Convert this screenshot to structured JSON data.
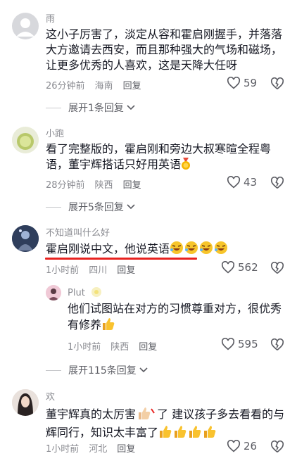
{
  "comments": [
    {
      "user": "雨",
      "text_lines": [
        "这小子厉害了，淡定从容和霍启刚握手，并落落",
        "大方邀请去西安，而且那种强大的气场和磁场，",
        "让更多优秀的人喜欢，这是天降大任呀"
      ],
      "time": "26分钟前",
      "location": "海南",
      "reply": "回复",
      "likes": "59",
      "expand": "展开1条回复"
    },
    {
      "user": "小跑",
      "text_lines": [
        "看了完整版的，霍启刚和旁边大叔寒暄全程粤",
        "语，董宇辉搭话只好用英语"
      ],
      "time": "28分钟前",
      "location": "陕西",
      "reply": "回复",
      "likes": "43",
      "expand": "展开5条回复"
    },
    {
      "user": "不知道叫什么好",
      "text_lines": [
        "霍启刚说中文，他说英语"
      ],
      "time": "1小时前",
      "location": "四川",
      "reply": "回复",
      "likes": "562",
      "reply_item": {
        "user": "Plut",
        "text_lines": [
          "他们试图站在对方的习惯尊重对方，很优秀",
          "有修养"
        ],
        "time": "1小时前",
        "location": "陕西",
        "reply": "回复",
        "likes": "595"
      },
      "expand": "展开115条回复"
    },
    {
      "user": "欢",
      "text_lines": [
        "董宇辉真的太厉害",
        "了 建议孩子多去看看的与",
        "辉同行，知识太丰富了"
      ],
      "time": "1小时前",
      "location": "河北",
      "reply": "回复",
      "likes": "26"
    }
  ],
  "colors": {
    "accent_underline": "#e8221f",
    "meta": "#8a8b91"
  }
}
